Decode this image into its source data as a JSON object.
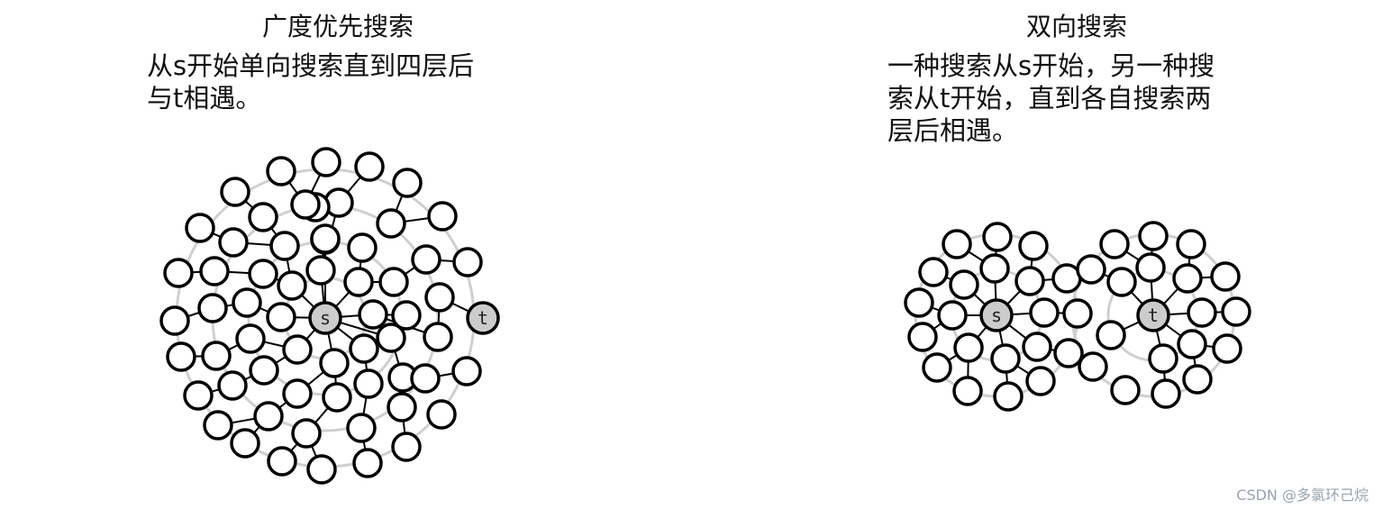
{
  "left": {
    "title": "广度优先搜索",
    "description_lines": [
      "从s开始单向搜索直到四层后",
      "与t相遇。"
    ],
    "source_label": "s",
    "target_label": "t"
  },
  "right": {
    "title": "双向搜索",
    "description_lines": [
      "一种搜索从s开始，另一种搜",
      "索从t开始，直到各自搜索两",
      "层后相遇。"
    ],
    "source_label": "s",
    "target_label": "t"
  },
  "watermark": "CSDN @多氯环己烷",
  "colors": {
    "ring": "#cfcfcf",
    "node_fill": "#ffffff",
    "node_stroke": "#000000",
    "endpoint_fill": "#cccccc"
  }
}
